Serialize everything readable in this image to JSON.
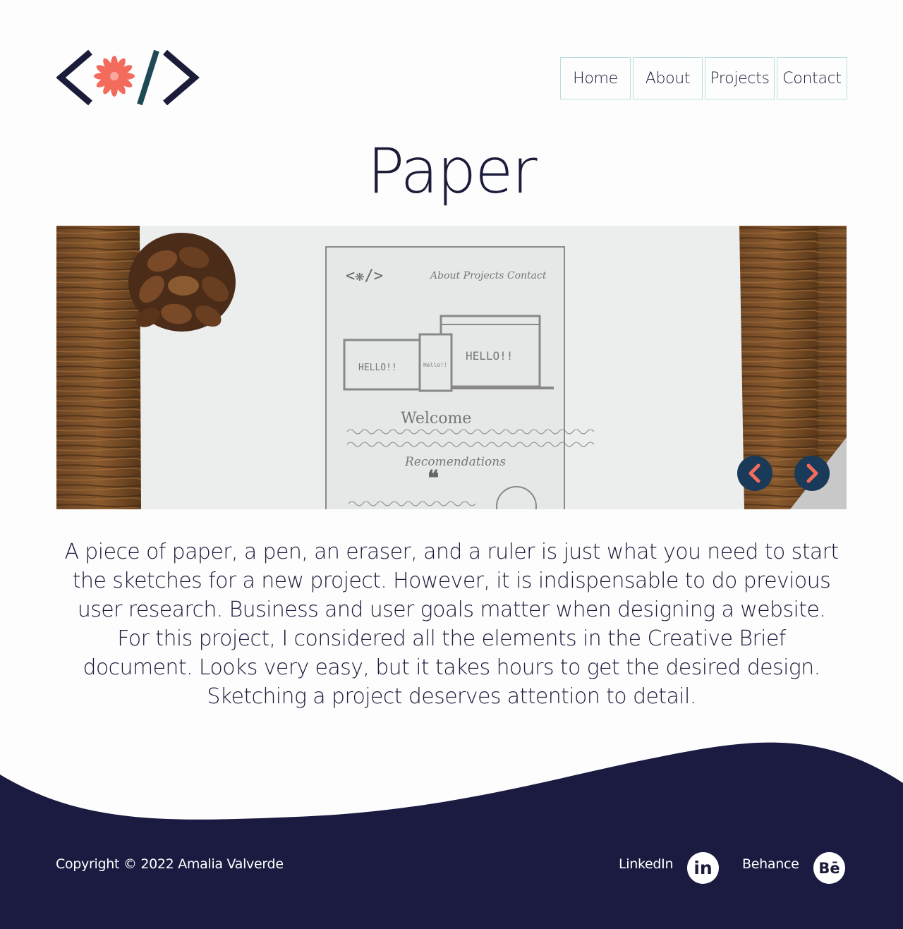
{
  "header": {
    "logo_icon": "code-brackets-flower-logo",
    "nav": [
      {
        "label": "Home"
      },
      {
        "label": "About"
      },
      {
        "label": "Projects"
      },
      {
        "label": "Contact"
      }
    ]
  },
  "main": {
    "title": "Paper",
    "carousel": {
      "image": "photo of a pencil sketch of a website on paper, pine cone and ruler on wooden table",
      "sketch_text": {
        "nav": "About  Projects  Contact",
        "hello_small": "HELLO!!",
        "hello_tiny": "Hello!!",
        "hello_large": "HELLO!!",
        "welcome": "Welcome",
        "recommendations": "Recomendations"
      },
      "prev_icon": "chevron-left-icon",
      "next_icon": "chevron-right-icon"
    },
    "description": "A piece of paper, a pen, an eraser, and a ruler is just what you need to start the sketches for a new project. However, it is indispensable to do previous user research. Business and user goals matter when designing a website. For this project, I considered all the elements in the Creative Brief document. Looks very easy, but it takes hours to get the desired design. Sketching a project deserves attention to detail."
  },
  "footer": {
    "copyright": "Copyright © 2022 Amalia Valverde",
    "linkedin_label": "LinkedIn",
    "linkedin_icon_text": "in",
    "behance_label": "Behance",
    "behance_icon_text": "Bē"
  },
  "colors": {
    "navy": "#1b1b3a",
    "accent_coral": "#f26b5b",
    "teal_slash": "#1d4a55",
    "nav_border": "#b9dede",
    "carousel_button": "#1a3a5a",
    "carousel_chevron": "#f26b5b"
  }
}
